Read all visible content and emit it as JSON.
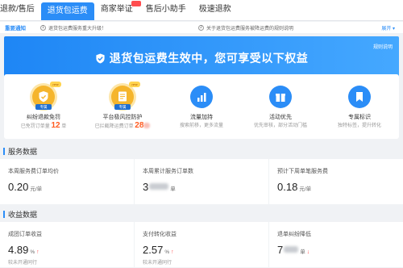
{
  "tabs": [
    {
      "label": "退款/售后",
      "active": false,
      "new": false
    },
    {
      "label": "退货包运费",
      "active": true,
      "new": false
    },
    {
      "label": "商家举证",
      "active": false,
      "new": true
    },
    {
      "label": "售后小助手",
      "active": false,
      "new": false
    },
    {
      "label": "极速退款",
      "active": false,
      "new": false
    }
  ],
  "notice": {
    "label": "重要通知",
    "items": [
      {
        "num": "1",
        "text": "退货包运费服务重大升级！"
      },
      {
        "num": "2",
        "text": "关于退货包运费服务被降运费的规则说明"
      }
    ],
    "expand_label": "展开 ▾"
  },
  "hero": {
    "title": "退货包运费生效中，您可享受以下权益",
    "rules_label": "规则说明"
  },
  "benefits": [
    {
      "name": "纠纷退款免罚",
      "sub_prefix": "已免罚订单量 ",
      "sub_value": "12",
      "sub_suffix": " 单",
      "tag": "专属",
      "new_tag": "new",
      "style": "gold",
      "icon": "shield-icon"
    },
    {
      "name": "平台极风控防护",
      "sub_prefix": "已拦截降运费订单 ",
      "sub_value": "28",
      "sub_suffix": "",
      "tag": "专属",
      "new_tag": "new",
      "style": "gold",
      "icon": "document-shield-icon"
    },
    {
      "name": "流量加持",
      "sub_prefix": "搜索前移，更多流量",
      "sub_value": "",
      "sub_suffix": "",
      "tag": "",
      "new_tag": "",
      "style": "blue",
      "icon": "bar-chart-icon"
    },
    {
      "name": "活动优先",
      "sub_prefix": "优先审核，部分活动门槛",
      "sub_value": "",
      "sub_suffix": "",
      "tag": "",
      "new_tag": "",
      "style": "blue",
      "icon": "gift-icon"
    },
    {
      "name": "专属标识",
      "sub_prefix": "独特标签，提升转化",
      "sub_value": "",
      "sub_suffix": "",
      "tag": "",
      "new_tag": "",
      "style": "blue",
      "icon": "bookmark-icon"
    }
  ],
  "service_section": {
    "title": "服务数据",
    "metrics": [
      {
        "label": "本周服务费订单均价",
        "value": "0.20",
        "unit": "元/单",
        "note": ""
      },
      {
        "label": "本周累计服务订单数",
        "value": "3",
        "unit": "单",
        "note": ""
      },
      {
        "label": "预计下周单笔服务费",
        "value": "0.18",
        "unit": "元/单",
        "note": ""
      }
    ]
  },
  "income_section": {
    "title": "收益数据",
    "metrics": [
      {
        "label": "成团订单收益",
        "value": "4.89",
        "unit": "%",
        "note": "较未开通同行"
      },
      {
        "label": "支付转化收益",
        "value": "2.57",
        "unit": "%",
        "note": "较未开通同行"
      },
      {
        "label": "退单纠纷降低",
        "value": "7",
        "unit": "单",
        "note": ""
      }
    ]
  },
  "colors": {
    "accent": "#2b8df7",
    "highlight": "#ff5a1f",
    "gold": "#f5b52c"
  }
}
